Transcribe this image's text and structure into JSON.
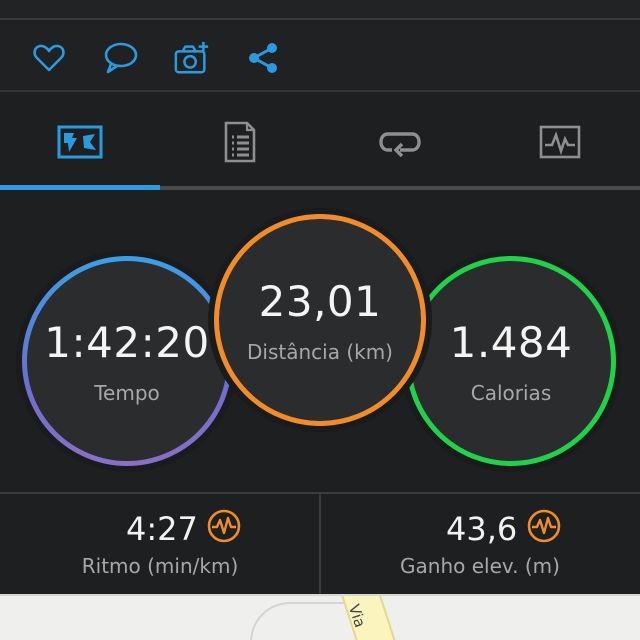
{
  "action_bar": {
    "icons": [
      "heart-icon",
      "comment-icon",
      "camera-add-icon",
      "share-icon"
    ],
    "accent": "#2a9be0"
  },
  "tabs": {
    "items": [
      "overview-map-icon",
      "details-list-icon",
      "laps-loop-icon",
      "chart-icon"
    ],
    "active_index": 0
  },
  "stats": {
    "time": {
      "value": "1:42:20",
      "label": "Tempo",
      "color": "#3aa0e6"
    },
    "distance": {
      "value": "23,01",
      "label": "Distância (km)",
      "color": "#f28c2a"
    },
    "calories": {
      "value": "1.484",
      "label": "Calorias",
      "color": "#22d14a"
    }
  },
  "metrics": {
    "pace": {
      "value": "4:27",
      "label": "Ritmo (min/km)",
      "icon": "pace-chart-icon"
    },
    "elevation": {
      "value": "43,6",
      "label": "Ganho elev. (m)",
      "icon": "elevation-chart-icon"
    }
  },
  "map": {
    "road_label": "Via"
  }
}
